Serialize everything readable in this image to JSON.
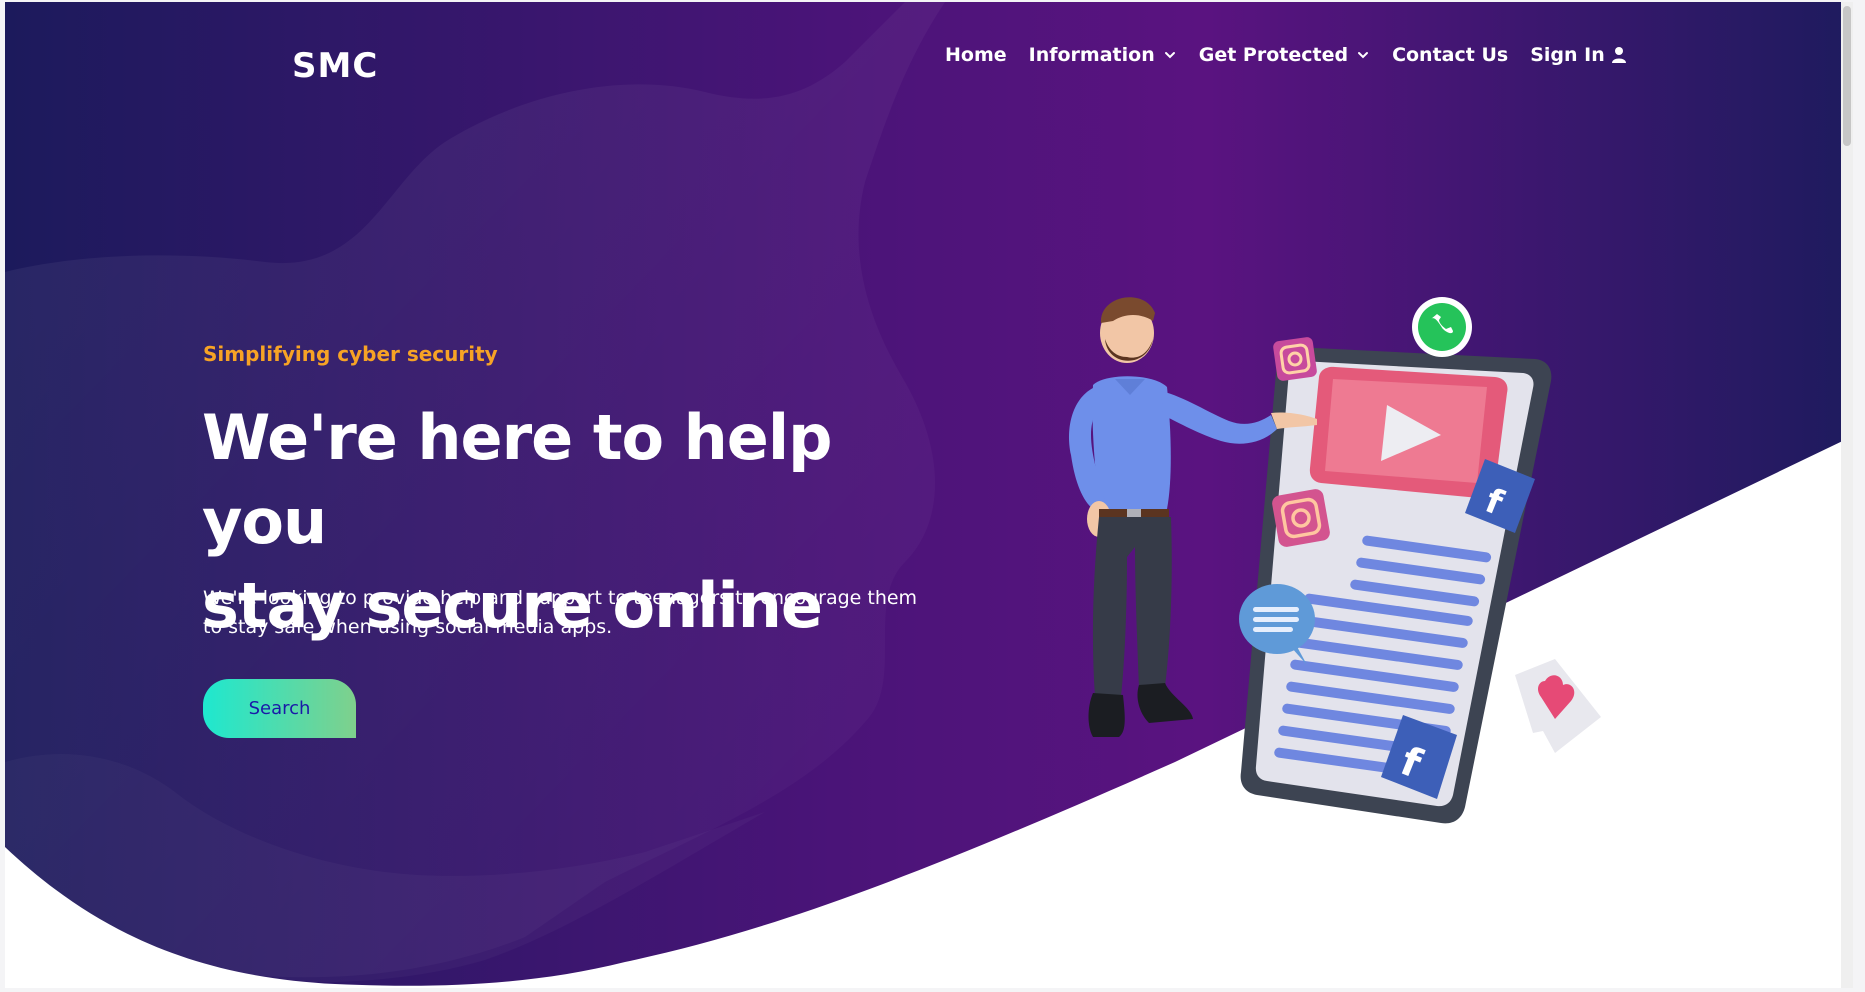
{
  "brand": {
    "logo_text": "SMC"
  },
  "nav": {
    "items": [
      {
        "label": "Home",
        "dropdown": false
      },
      {
        "label": "Information",
        "dropdown": true
      },
      {
        "label": "Get Protected",
        "dropdown": true
      },
      {
        "label": "Contact Us",
        "dropdown": false
      },
      {
        "label": "Sign In",
        "dropdown": false,
        "icon": "user-icon"
      }
    ]
  },
  "hero": {
    "tagline": "Simplifying cyber security",
    "headline_line1": "We're here to help you",
    "headline_line2": "stay secure online",
    "description": "We're looking to provide help and support to teenagers to encourage them to stay safe when using social media apps.",
    "search_button_label": "Search"
  },
  "illustration": {
    "icons": [
      "person-figure",
      "phone-icon",
      "play-icon",
      "whatsapp-icon",
      "instagram-icon",
      "facebook-icon",
      "chat-bubble-icon",
      "heart-icon"
    ]
  },
  "colors": {
    "bg_dark": "#1c1a5c",
    "bg_purple": "#5a1380",
    "accent_orange": "#f7a325",
    "button_start": "#1ee8cf",
    "button_end": "#7fd08c",
    "button_text": "#1a1aa8"
  }
}
